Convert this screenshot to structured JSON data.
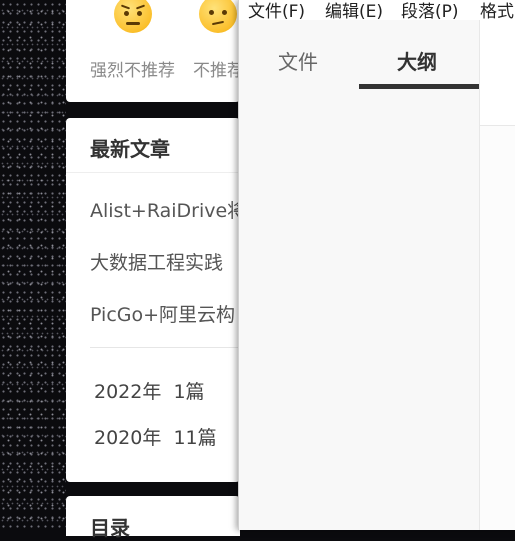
{
  "blog": {
    "rating": {
      "options": [
        {
          "label": "强烈不推荐",
          "icon": "angry-face-icon"
        },
        {
          "label": "不推荐",
          "icon": "confused-face-icon"
        }
      ]
    },
    "latest": {
      "title": "最新文章",
      "articles": [
        "Alist+RaiDrive将",
        "大数据工程实践",
        "PicGo+阿里云构"
      ],
      "archives": [
        {
          "year": "2022年",
          "count": "1篇"
        },
        {
          "year": "2020年",
          "count": "11篇"
        }
      ]
    },
    "toc": {
      "title": "目录"
    }
  },
  "app": {
    "menu": [
      "文件(F)",
      "编辑(E)",
      "段落(P)",
      "格式"
    ],
    "sidebar": {
      "tabs": [
        {
          "label": "文件",
          "active": false
        },
        {
          "label": "大纲",
          "active": true
        }
      ]
    }
  }
}
